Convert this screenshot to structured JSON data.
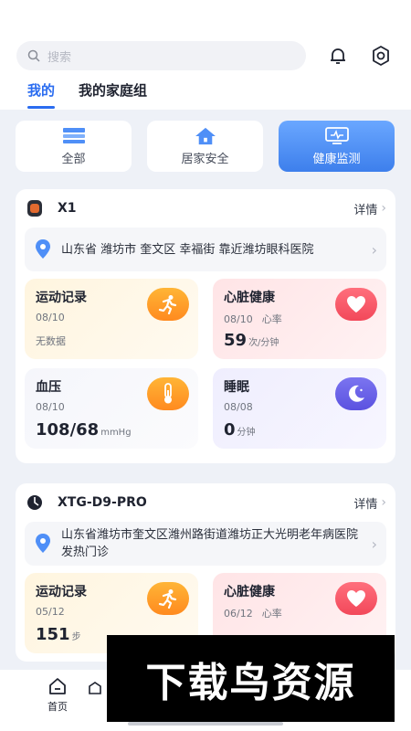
{
  "header": {
    "search_placeholder": "搜索",
    "tabs": [
      {
        "label": "我的",
        "active": true
      },
      {
        "label": "我的家庭组",
        "active": false
      }
    ]
  },
  "categories": [
    {
      "label": "全部",
      "icon": "list-icon",
      "active": false
    },
    {
      "label": "居家安全",
      "icon": "house-icon",
      "active": false
    },
    {
      "label": "健康监测",
      "icon": "monitor-icon",
      "active": true
    }
  ],
  "devices": [
    {
      "name": "X1",
      "detail_label": "详情",
      "address": "山东省 潍坊市 奎文区 幸福街 靠近潍坊眼科医院",
      "tiles": {
        "exercise": {
          "title": "运动记录",
          "date": "08/10",
          "value": "",
          "nodata": "无数据"
        },
        "heart": {
          "title": "心脏健康",
          "date": "08/10",
          "metric": "心率",
          "value": "59",
          "unit": "次/分钟"
        },
        "blood": {
          "title": "血压",
          "date": "08/10",
          "value": "108/68",
          "unit": "mmHg"
        },
        "sleep": {
          "title": "睡眠",
          "date": "08/08",
          "value": "0",
          "unit": "分钟"
        }
      }
    },
    {
      "name": "XTG-D9-PRO",
      "detail_label": "详情",
      "address": "山东省潍坊市奎文区潍州路街道潍坊正大光明老年病医院发热门诊",
      "tiles": {
        "exercise": {
          "title": "运动记录",
          "date": "05/12",
          "value": "151",
          "unit": "步"
        },
        "heart": {
          "title": "心脏健康",
          "date": "06/12",
          "metric": "心率",
          "value": "",
          "unit": ""
        }
      }
    }
  ],
  "bottom_nav": {
    "home_label": "首页"
  },
  "watermark": "下载鸟资源",
  "colors": {
    "accent": "#2a6cf0",
    "orange": "#ff8a1f",
    "red": "#f2485a",
    "purple": "#5b52e0"
  }
}
